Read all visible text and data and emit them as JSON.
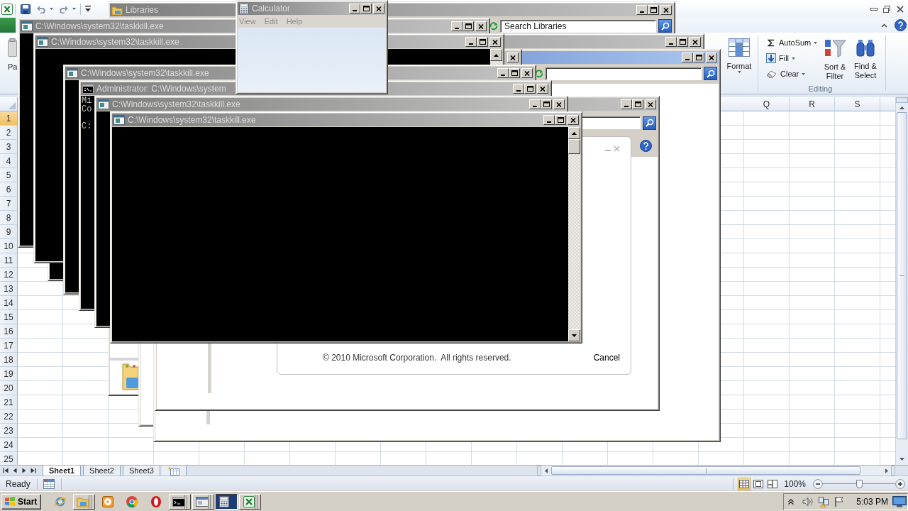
{
  "excel": {
    "ribbon": {
      "paste_label": "Pa",
      "format_label": "Format",
      "editing_items": [
        {
          "label": "AutoSum"
        },
        {
          "label": "Fill"
        },
        {
          "label": "Clear"
        }
      ],
      "sort_label": "Sort & Filter",
      "find_label": "Find & Select",
      "group_label": "Editing"
    },
    "columns": [
      {
        "label": "Q",
        "selected": false
      },
      {
        "label": "R",
        "selected": false
      },
      {
        "label": "S",
        "selected": false
      }
    ],
    "rows": [
      {
        "label": "1",
        "selected": true
      },
      {
        "label": "2",
        "selected": false
      },
      {
        "label": "3",
        "selected": false
      },
      {
        "label": "4",
        "selected": false
      },
      {
        "label": "5",
        "selected": false
      },
      {
        "label": "6",
        "selected": false
      },
      {
        "label": "7",
        "selected": false
      },
      {
        "label": "8",
        "selected": false
      },
      {
        "label": "9",
        "selected": false
      },
      {
        "label": "10",
        "selected": false
      },
      {
        "label": "11",
        "selected": false
      },
      {
        "label": "12",
        "selected": false
      },
      {
        "label": "13",
        "selected": false
      },
      {
        "label": "14",
        "selected": false
      },
      {
        "label": "15",
        "selected": false
      },
      {
        "label": "16",
        "selected": false
      },
      {
        "label": "17",
        "selected": false
      },
      {
        "label": "18",
        "selected": false
      },
      {
        "label": "19",
        "selected": false
      },
      {
        "label": "20",
        "selected": false
      },
      {
        "label": "21",
        "selected": false
      },
      {
        "label": "22",
        "selected": false
      },
      {
        "label": "23",
        "selected": false
      },
      {
        "label": "24",
        "selected": false
      },
      {
        "label": "25",
        "selected": false
      }
    ],
    "sheet_tabs": [
      {
        "label": "Sheet1",
        "selected": true
      },
      {
        "label": "Sheet2",
        "selected": false
      },
      {
        "label": "Sheet3",
        "selected": false
      }
    ],
    "status_bar": {
      "text": "Ready",
      "views": [
        {
          "selected": true
        },
        {
          "selected": false
        },
        {
          "selected": false
        }
      ],
      "zoom_text": "100%",
      "zoom": {
        "level": 0.5
      }
    }
  },
  "windows": [
    {
      "kind": "explorer",
      "title": "Libraries",
      "active": false,
      "toolbar": true,
      "search_placeholder": "Search Libraries"
    },
    {
      "kind": "explorer",
      "active": false
    },
    {
      "kind": "explorer",
      "active": true,
      "toolbar": true
    },
    {
      "kind": "help",
      "active": false
    },
    {
      "kind": "dialog",
      "footer_text": "© 2010 Microsoft Corporation.  All rights reserved.",
      "button": "Cancel"
    },
    {
      "kind": "console",
      "title": "C:\\Windows\\system32\\taskkill.exe",
      "active": false
    },
    {
      "kind": "console",
      "active": false
    },
    {
      "kind": "console",
      "title": "C:\\Windows\\system32\\taskkill.exe",
      "active": false,
      "scrollbar": true
    },
    {
      "kind": "console",
      "title": "C:\\Windows\\system32\\taskkill.exe",
      "active": false
    },
    {
      "kind": "prompt",
      "title": "Administrator: C:\\Windows\\system",
      "active": false,
      "output": [
        [
          "Mi",
          "Co"
        ],
        [
          "C:"
        ]
      ]
    },
    {
      "kind": "console",
      "title": "C:\\Windows\\system32\\taskkill.exe",
      "active": false
    },
    {
      "kind": "console",
      "title": "C:\\Windows\\system32\\taskkill.exe",
      "active": false,
      "scrollbar": true
    },
    {
      "kind": "calculator",
      "title": "Calculator",
      "active": false,
      "menu": [
        {
          "label": "View"
        },
        {
          "label": "Edit"
        },
        {
          "label": "Help"
        }
      ]
    }
  ],
  "taskbar": {
    "start": "Start",
    "items": [
      {
        "selected": false,
        "grouped": false
      },
      {
        "selected": false,
        "grouped": true
      },
      {
        "selected": false,
        "grouped": false
      },
      {
        "selected": false,
        "grouped": false
      },
      {
        "selected": false,
        "grouped": false
      },
      {
        "selected": false,
        "grouped": true
      },
      {
        "selected": false,
        "grouped": true
      },
      {
        "selected": true,
        "grouped": false
      },
      {
        "selected": false,
        "grouped": true
      }
    ],
    "clock": "5:03 PM"
  }
}
